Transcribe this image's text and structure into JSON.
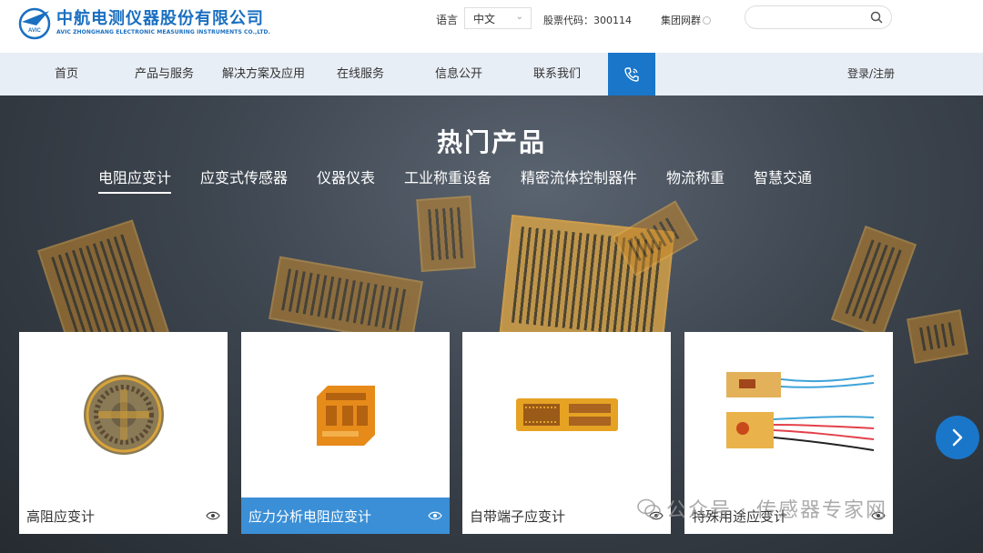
{
  "header": {
    "logo_cn": "中航电测仪器股份有限公司",
    "logo_en": "AVIC ZHONGHANG ELECTRONIC MEASURING INSTRUMENTS CO.,LTD.",
    "logo_badge": "AVIC",
    "language_label": "语言",
    "language_value": "中文",
    "stock_code": "股票代码：300114",
    "group_network": "集团网群",
    "search_placeholder": ""
  },
  "nav": {
    "items": [
      "首页",
      "产品与服务",
      "解决方案及应用",
      "在线服务",
      "信息公开",
      "联系我们"
    ],
    "login": "登录/注册"
  },
  "hero": {
    "title": "热门产品",
    "tabs": [
      "电阻应变计",
      "应变式传感器",
      "仪器仪表",
      "工业称重设备",
      "精密流体控制器件",
      "物流称重",
      "智慧交通"
    ],
    "active_tab": 0
  },
  "products": [
    {
      "name": "高阻应变计",
      "active": false
    },
    {
      "name": "应力分析电阻应变计",
      "active": true
    },
    {
      "name": "自带端子应变计",
      "active": false
    },
    {
      "name": "特殊用途应变计",
      "active": false
    }
  ],
  "watermark": {
    "text": "公众号 · 传感器专家网"
  },
  "colors": {
    "brand_blue": "#1a76c8",
    "active_card": "#3b8fd6",
    "nav_bg": "#e8eef5"
  }
}
